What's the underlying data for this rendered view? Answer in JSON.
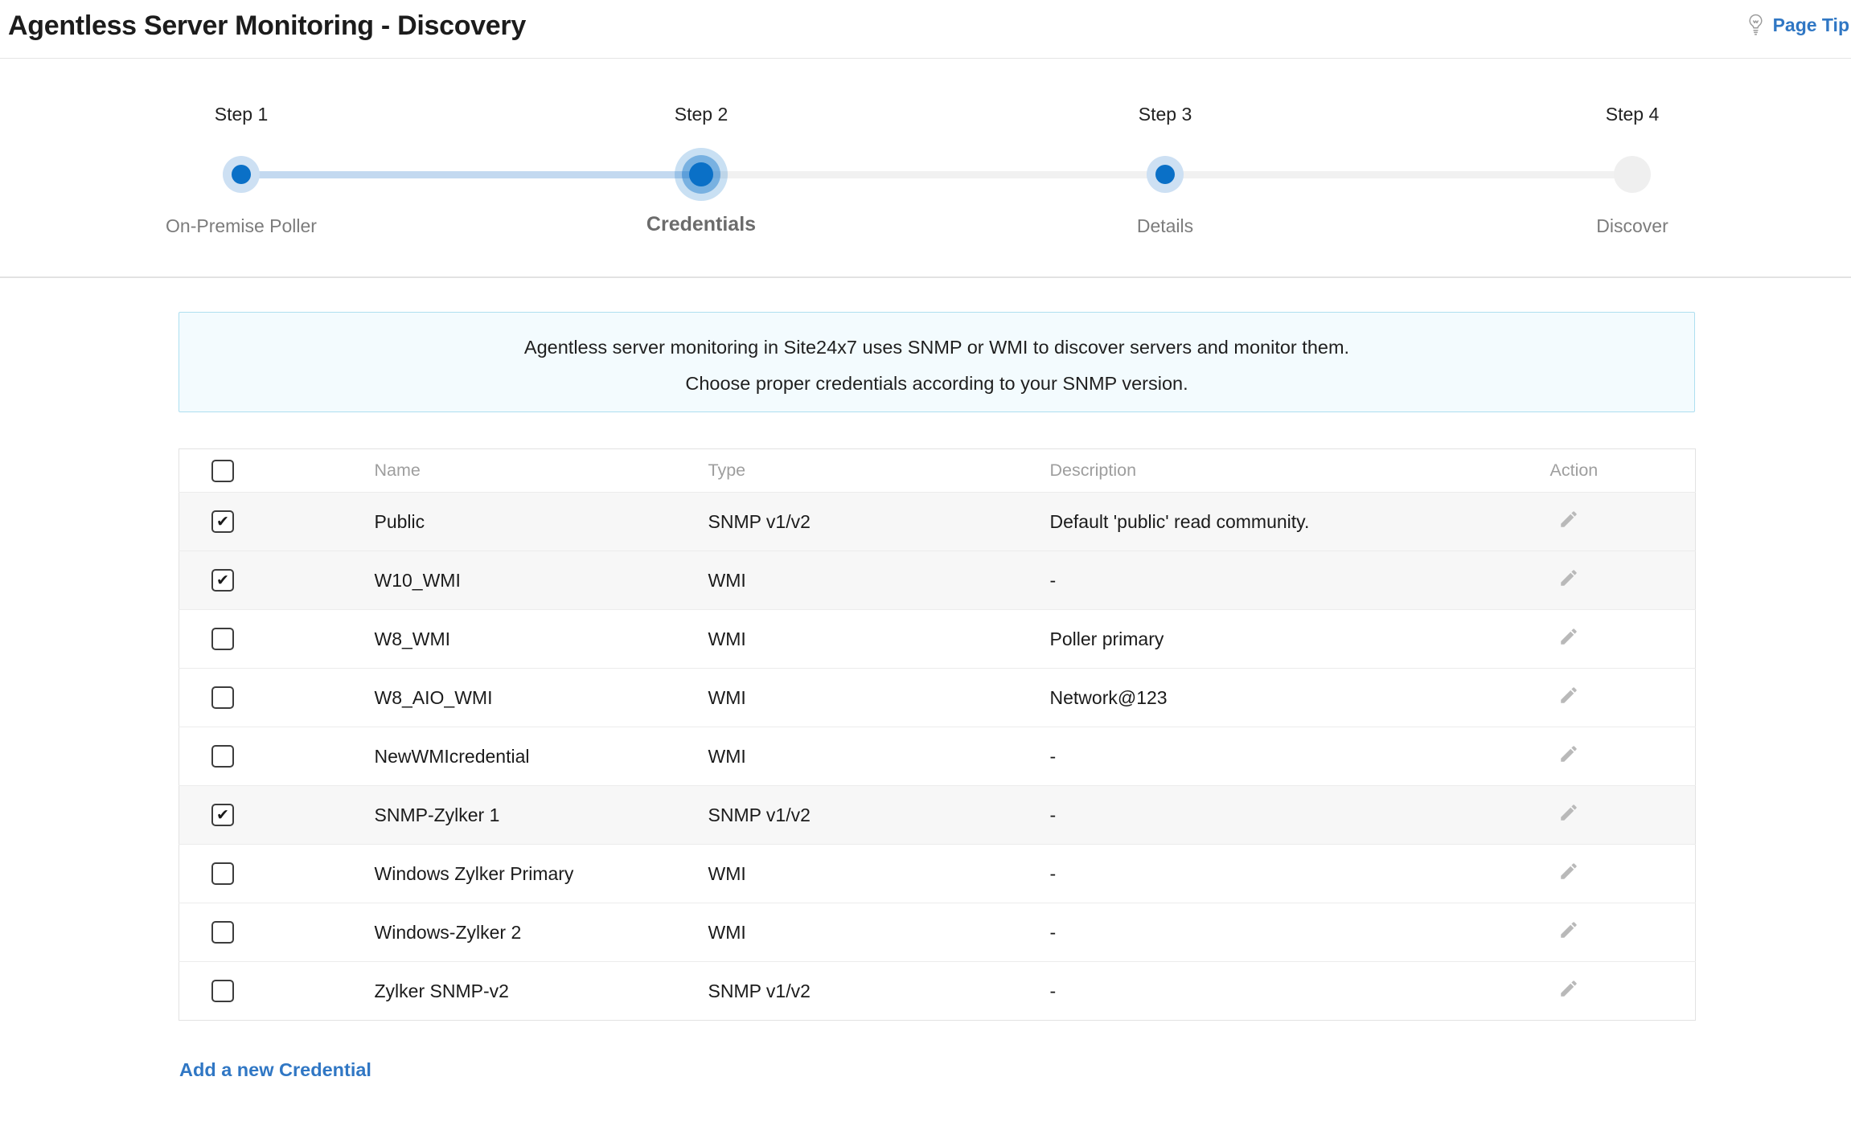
{
  "page": {
    "title": "Agentless Server Monitoring - Discovery",
    "page_tip_label": "Page Tip"
  },
  "stepper": {
    "steps": [
      {
        "step": "Step 1",
        "label": "On-Premise Poller",
        "state": "completed"
      },
      {
        "step": "Step 2",
        "label": "Credentials",
        "state": "active"
      },
      {
        "step": "Step 3",
        "label": "Details",
        "state": "upcoming"
      },
      {
        "step": "Step 4",
        "label": "Discover",
        "state": "future"
      }
    ]
  },
  "banner": {
    "line1": "Agentless server monitoring in Site24x7 uses SNMP or WMI to discover servers and monitor them.",
    "line2": "Choose proper credentials according to your SNMP version."
  },
  "credentials_table": {
    "select_all_checked": false,
    "headers": {
      "name": "Name",
      "type": "Type",
      "description": "Description",
      "action": "Action"
    },
    "rows": [
      {
        "checked": true,
        "name": "Public",
        "type": "SNMP v1/v2",
        "description": "Default 'public' read community."
      },
      {
        "checked": true,
        "name": "W10_WMI",
        "type": "WMI",
        "description": "-"
      },
      {
        "checked": false,
        "name": "W8_WMI",
        "type": "WMI",
        "description": "Poller primary"
      },
      {
        "checked": false,
        "name": "W8_AIO_WMI",
        "type": "WMI",
        "description": "Network@123"
      },
      {
        "checked": false,
        "name": "NewWMIcredential",
        "type": "WMI",
        "description": "-"
      },
      {
        "checked": true,
        "name": "SNMP-Zylker 1",
        "type": "SNMP v1/v2",
        "description": "-"
      },
      {
        "checked": false,
        "name": "Windows Zylker Primary",
        "type": "WMI",
        "description": "-"
      },
      {
        "checked": false,
        "name": "Windows-Zylker 2",
        "type": "WMI",
        "description": "-"
      },
      {
        "checked": false,
        "name": "Zylker SNMP-v2",
        "type": "SNMP v1/v2",
        "description": "-"
      }
    ]
  },
  "actions": {
    "add_credential_label": "Add a new Credential"
  },
  "icons": {
    "page_tip": "lightbulb-icon",
    "row_action": "edit-pencil-icon"
  },
  "colors": {
    "accent_blue": "#0a70c7",
    "halo_blue": "#cde0f3",
    "connector_done": "#c3d9f0",
    "connector_todo": "#f1f1f1",
    "link_blue": "#3077c4",
    "banner_bg": "#f3fbfe",
    "banner_border": "#aedff0",
    "checked_row_bg": "#f7f7f7",
    "header_text_gray": "#9e9e9e",
    "icon_gray": "#b9b9b9"
  }
}
